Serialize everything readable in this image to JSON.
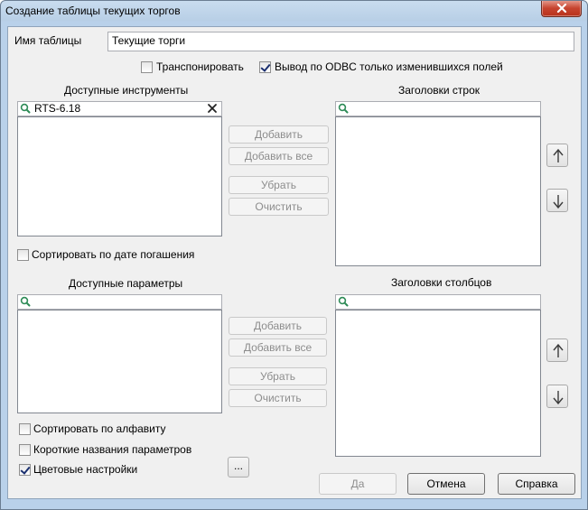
{
  "window": {
    "title": "Создание таблицы текущих торгов"
  },
  "table_name": {
    "label": "Имя таблицы",
    "value": "Текущие торги"
  },
  "options": {
    "transpose_label": "Транспонировать",
    "transpose_checked": false,
    "odbc_label": "Вывод по ODBC только изменившихся  полей",
    "odbc_checked": true
  },
  "instruments": {
    "heading": "Доступные инструменты",
    "search_value": "RTS-6.18",
    "sort_label": "Сортировать по дате погашения",
    "sort_checked": false,
    "buttons": {
      "add": "Добавить",
      "add_all": "Добавить все",
      "remove": "Убрать",
      "clear": "Очистить"
    }
  },
  "row_headers": {
    "heading": "Заголовки строк",
    "search_value": ""
  },
  "parameters": {
    "heading": "Доступные параметры",
    "search_value": "",
    "sort_alpha_label": "Сортировать по алфавиту",
    "sort_alpha_checked": false,
    "short_names_label": "Короткие названия параметров",
    "short_names_checked": false,
    "color_settings_label": "Цветовые настройки",
    "color_settings_checked": true,
    "more_button": "...",
    "buttons": {
      "add": "Добавить",
      "add_all": "Добавить все",
      "remove": "Убрать",
      "clear": "Очистить"
    }
  },
  "column_headers": {
    "heading": "Заголовки столбцов",
    "search_value": ""
  },
  "dialog_buttons": {
    "ok": "Да",
    "cancel": "Отмена",
    "help": "Справка"
  },
  "icons": {
    "search": "magnifier-icon",
    "clear": "close-x-icon",
    "up": "arrow-up-icon",
    "down": "arrow-down-icon",
    "close": "close-icon"
  },
  "colors": {
    "frame": "#b9d1ea",
    "client": "#f0f0f0",
    "close_button": "#c7442f"
  }
}
